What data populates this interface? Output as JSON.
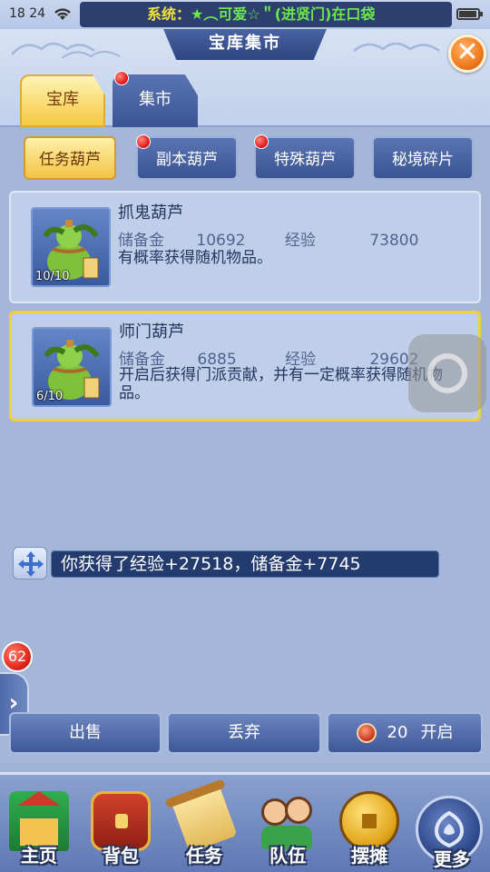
{
  "status_bar": {
    "time": "18 24",
    "marquee_prefix": "系统：",
    "marquee_text": "★︵可爱☆＂(进贤门)在口袋"
  },
  "title": "宝库集市",
  "tabs": [
    {
      "label": "宝库",
      "active": true
    },
    {
      "label": "集市",
      "active": false,
      "has_dot": true
    }
  ],
  "categories": [
    {
      "label": "任务葫芦",
      "active": true,
      "has_dot": false
    },
    {
      "label": "副本葫芦",
      "active": false,
      "has_dot": true
    },
    {
      "label": "特殊葫芦",
      "active": false,
      "has_dot": true
    },
    {
      "label": "秘境碎片",
      "active": false,
      "has_dot": false
    }
  ],
  "items": [
    {
      "name": "抓鬼葫芦",
      "count": "10/10",
      "icon_char": "鬼",
      "fund_label": "储备金",
      "fund_value": "10692",
      "exp_label": "经验",
      "exp_value": "73800",
      "desc": "有概率获得随机物品。",
      "selected": false
    },
    {
      "name": "师门葫芦",
      "count": "6/10",
      "icon_char": "师",
      "fund_label": "储备金",
      "fund_value": "6885",
      "exp_label": "经验",
      "exp_value": "29602",
      "desc": "开启后获得门派贡献，并有一定概率获得随机物品。",
      "selected": true
    }
  ],
  "message": "你获得了经验+27518，储备金+7745",
  "side_badge": "62",
  "actions": {
    "sell": "出售",
    "discard": "丢弃",
    "open_count": "20",
    "open": "开启"
  },
  "bottom_nav": [
    {
      "label": "主页",
      "icon": "palace-icon"
    },
    {
      "label": "背包",
      "icon": "treasure-chest-icon"
    },
    {
      "label": "任务",
      "icon": "scroll-icon"
    },
    {
      "label": "队伍",
      "icon": "team-icon"
    },
    {
      "label": "摆摊",
      "icon": "coin-icon"
    },
    {
      "label": "更多",
      "icon": "more-icon"
    }
  ],
  "colors": {
    "accent_gold": "#f4c63e",
    "panel_blue": "#3b5493",
    "close_orange": "#f07a1e",
    "marquee_yellow": "#f2e43a",
    "marquee_green": "#6be84d"
  }
}
